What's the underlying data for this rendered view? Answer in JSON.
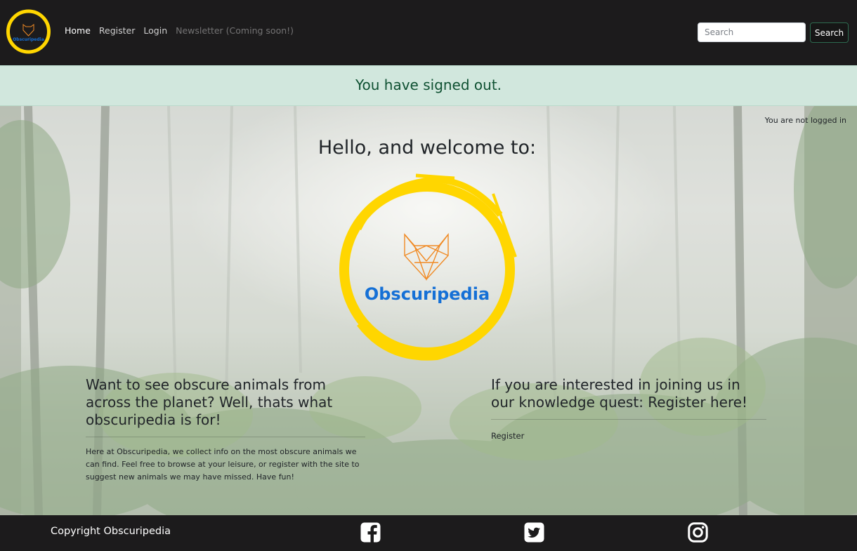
{
  "nav": {
    "logo_text": "Obscuripedia",
    "links": [
      {
        "label": "Home"
      },
      {
        "label": "Register"
      },
      {
        "label": "Login"
      },
      {
        "label": "Newsletter (Coming soon!)"
      }
    ],
    "search_placeholder": "Search",
    "search_button": "Search"
  },
  "alert": {
    "message": "You have signed out."
  },
  "status": {
    "login_status": "You are not logged in"
  },
  "hero": {
    "title": "Hello, and welcome to:",
    "logo_text": "Obscuripedia"
  },
  "left": {
    "heading": "Want to see obscure animals from across the planet? Well, thats what obscuripedia is for!",
    "body": "Here at Obscuripedia, we collect info on the most obscure animals we can find. Feel free to browse at your leisure, or register with the site to suggest new animals we may have missed. Have fun!"
  },
  "right": {
    "heading": "If you are interested in joining us in our knowledge quest: Register here!",
    "link": "Register"
  },
  "footer": {
    "copyright": "Copyright Obscuripedia",
    "social": [
      "facebook-icon",
      "twitter-icon",
      "instagram-icon"
    ]
  },
  "colors": {
    "navbar_bg": "#1c1b1c",
    "alert_bg": "#d1e7dd",
    "alert_text": "#0f5132",
    "logo_ring": "#ffd600",
    "logo_fox": "#f08a24",
    "logo_word": "#1570d6"
  }
}
